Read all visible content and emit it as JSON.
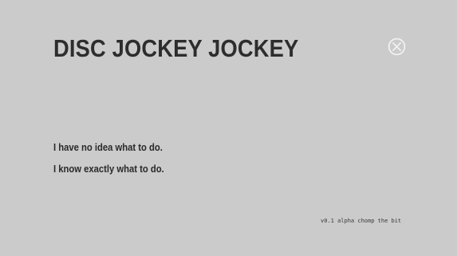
{
  "title": "DISC JOCKEY JOCKEY",
  "close_button": {
    "icon": "close-circle-icon"
  },
  "menu": {
    "items": [
      {
        "label": "I have no idea what to do."
      },
      {
        "label": "I know exactly what to do."
      }
    ]
  },
  "version": "v0.1 alpha chomp the bit",
  "colors": {
    "background": "#cbcbcb",
    "text": "#2e2e2e",
    "icon": "#f0f0f0"
  }
}
